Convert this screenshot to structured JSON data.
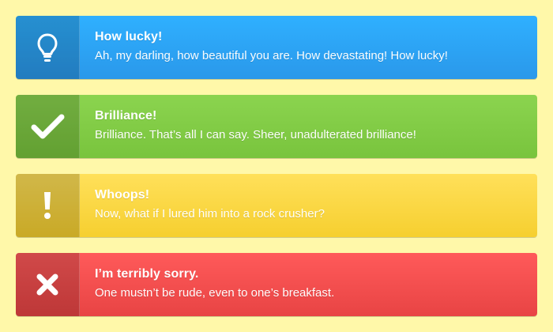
{
  "alerts": [
    {
      "type": "info",
      "icon": "lightbulb-icon",
      "title": "How lucky!",
      "message": "Ah, my darling, how beautiful you are. How devastating! How lucky!"
    },
    {
      "type": "success",
      "icon": "checkmark-icon",
      "title": "Brilliance!",
      "message": "Brilliance. That’s all I can say. Sheer, unadulterated brilliance!"
    },
    {
      "type": "warning",
      "icon": "exclamation-icon",
      "title": "Whoops!",
      "message": "Now, what if I lured him into a rock crusher?"
    },
    {
      "type": "error",
      "icon": "close-icon",
      "title": "I’m terribly sorry.",
      "message": "One mustn’t be rude, even to one’s breakfast."
    }
  ],
  "colors": {
    "page_background": "#fff8a9",
    "info": "#2a98ea",
    "success": "#79c43d",
    "warning": "#f6cf2f",
    "error": "#e84444"
  }
}
